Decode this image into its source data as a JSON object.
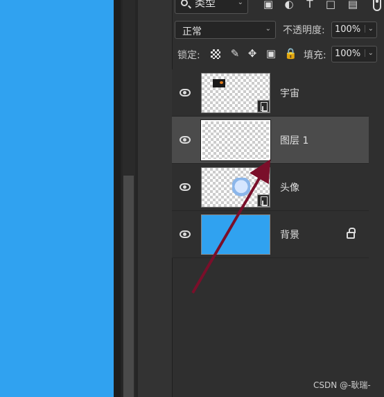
{
  "filter": {
    "kind_label": "类型"
  },
  "blend": {
    "mode": "正常",
    "opacity_label": "不透明度:",
    "opacity": "100%"
  },
  "locks": {
    "label": "锁定:",
    "fill_label": "填充:",
    "fill": "100%"
  },
  "layers": [
    {
      "name": "宇宙",
      "type": "smart-object",
      "selected": false
    },
    {
      "name": "图层 1",
      "type": "empty",
      "selected": true
    },
    {
      "name": "头像",
      "type": "smart-object",
      "selected": false
    },
    {
      "name": "背景",
      "type": "background",
      "selected": false,
      "locked": true
    }
  ],
  "colors": {
    "canvas": "#30a2f0",
    "panel": "#2f2f2f",
    "selected": "#4b4b4b",
    "annotation_arrow": "#7a0f2a"
  },
  "watermark": "CSDN @-耿瑞-"
}
